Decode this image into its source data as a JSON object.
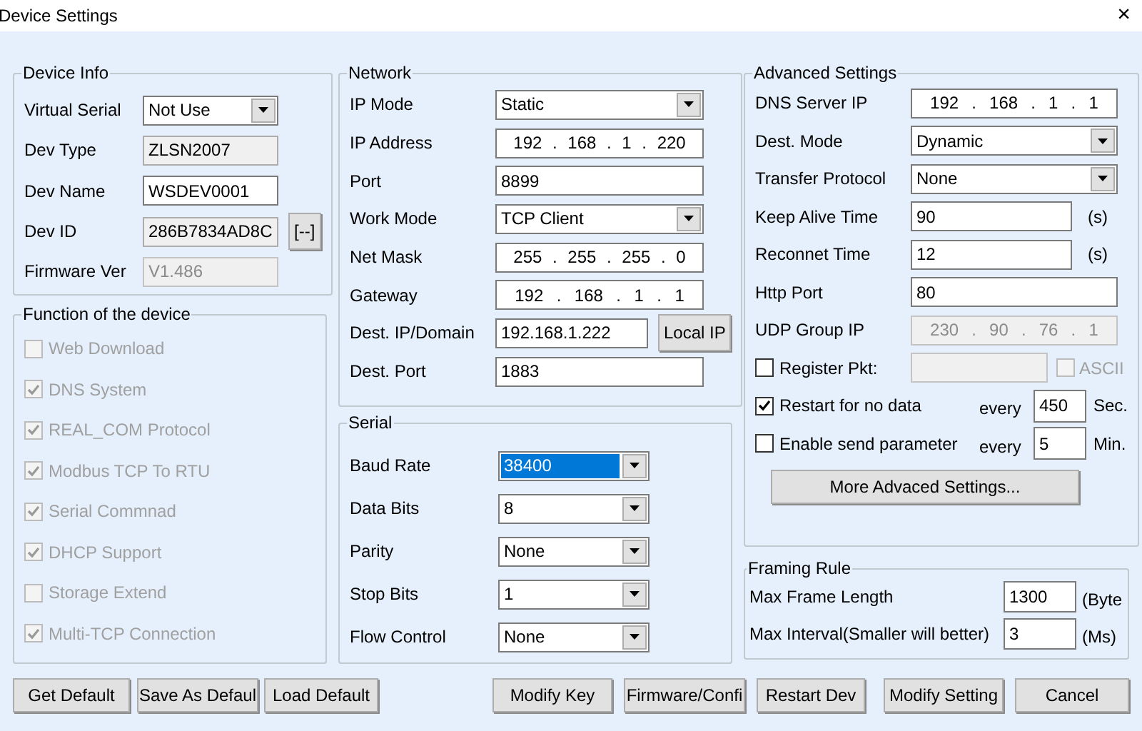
{
  "window": {
    "title": "Device Settings",
    "close": "×"
  },
  "device_info": {
    "title": "Device Info",
    "rows": [
      {
        "kind": "select",
        "label": "Virtual Serial",
        "value": "Not Use"
      },
      {
        "kind": "readonly",
        "label": "Dev Type",
        "value": "ZLSN2007"
      },
      {
        "kind": "input",
        "label": "Dev Name",
        "value": "WSDEV0001"
      },
      {
        "kind": "readonly",
        "label": "Dev ID",
        "value": "286B7834AD8C",
        "button": "[--]"
      },
      {
        "kind": "disabled",
        "label": "Firmware Ver",
        "value": "V1.486"
      }
    ]
  },
  "functions": {
    "title": "Function of the device",
    "items": [
      {
        "label": "Web Download",
        "checked": false,
        "disabled": true
      },
      {
        "label": "DNS System",
        "checked": true,
        "disabled": true
      },
      {
        "label": "REAL_COM Protocol",
        "checked": true,
        "disabled": true
      },
      {
        "label": "Modbus TCP To RTU",
        "checked": true,
        "disabled": true
      },
      {
        "label": "Serial Commnad",
        "checked": true,
        "disabled": true
      },
      {
        "label": "DHCP Support",
        "checked": true,
        "disabled": true
      },
      {
        "label": "Storage Extend",
        "checked": false,
        "disabled": true
      },
      {
        "label": "Multi-TCP Connection",
        "checked": true,
        "disabled": true
      }
    ]
  },
  "network": {
    "title": "Network",
    "rows": [
      {
        "kind": "select",
        "label": "IP Mode",
        "value": "Static"
      },
      {
        "kind": "ip",
        "label": "IP Address",
        "parts": [
          "192",
          ".",
          "168",
          ".",
          "1",
          ".",
          "220"
        ]
      },
      {
        "kind": "input",
        "label": "Port",
        "value": "8899"
      },
      {
        "kind": "select",
        "label": "Work Mode",
        "value": "TCP Client"
      },
      {
        "kind": "ip",
        "label": "Net Mask",
        "parts": [
          "255",
          ".",
          "255",
          ".",
          "255",
          ".",
          "0"
        ]
      },
      {
        "kind": "ip",
        "label": "Gateway",
        "parts": [
          "192",
          ".",
          "168",
          ".",
          "1",
          ".",
          "1"
        ]
      },
      {
        "kind": "input",
        "label": "Dest. IP/Domain",
        "value": "192.168.1.222",
        "button": "Local IP"
      },
      {
        "kind": "input",
        "label": "Dest. Port",
        "value": "1883"
      }
    ]
  },
  "serial": {
    "title": "Serial",
    "rows": [
      {
        "kind": "select",
        "label": "Baud Rate",
        "value": "38400",
        "highlighted": true
      },
      {
        "kind": "select",
        "label": "Data Bits",
        "value": "8",
        "highlighted": false
      },
      {
        "kind": "select",
        "label": "Parity",
        "value": "None",
        "highlighted": false
      },
      {
        "kind": "select",
        "label": "Stop Bits",
        "value": "1",
        "highlighted": false
      },
      {
        "kind": "select",
        "label": "Flow Control",
        "value": "None",
        "highlighted": false
      }
    ]
  },
  "advanced": {
    "title": "Advanced Settings",
    "rows": [
      {
        "kind": "ip",
        "label": "DNS Server IP",
        "parts": [
          "192",
          ".",
          "168",
          ".",
          "1",
          ".",
          "1"
        ]
      },
      {
        "kind": "select",
        "label": "Dest. Mode",
        "value": "Dynamic"
      },
      {
        "kind": "select",
        "label": "Transfer Protocol",
        "value": "None"
      },
      {
        "kind": "input",
        "label": "Keep Alive Time",
        "value": "90",
        "unit": "(s)"
      },
      {
        "kind": "input",
        "label": "Reconnet Time",
        "value": "12",
        "unit": "(s)"
      },
      {
        "kind": "input",
        "label": "Http Port",
        "value": "80"
      },
      {
        "kind": "ip_disabled",
        "label": "UDP Group IP",
        "parts": [
          "230",
          ".",
          "90",
          ".",
          "76",
          ".",
          "1"
        ]
      },
      {
        "kind": "register",
        "label": "Register Pkt:",
        "checked": false,
        "option": {
          "label": "ASCII",
          "checked": false
        }
      },
      {
        "kind": "repeat",
        "label": "Restart for no data",
        "checked": true,
        "every": "every",
        "value": "450",
        "unit": "Sec."
      },
      {
        "kind": "repeat",
        "label": "Enable send parameter",
        "checked": false,
        "every": "every",
        "value": "5",
        "unit": "Min."
      },
      {
        "kind": "button",
        "label": "More Advaced Settings..."
      }
    ]
  },
  "framing": {
    "title": "Framing Rule",
    "rows": [
      {
        "label": "Max Frame Length",
        "value": "1300",
        "unit": "(Byte"
      },
      {
        "label": "Max Interval(Smaller will better)",
        "value": "3",
        "unit": "(Ms)"
      }
    ]
  },
  "buttons": [
    "Get Default",
    "Save As Defaul",
    "Load Default",
    "Modify Key",
    "Firmware/Confi",
    "Restart Dev",
    "Modify Setting",
    "Cancel"
  ]
}
